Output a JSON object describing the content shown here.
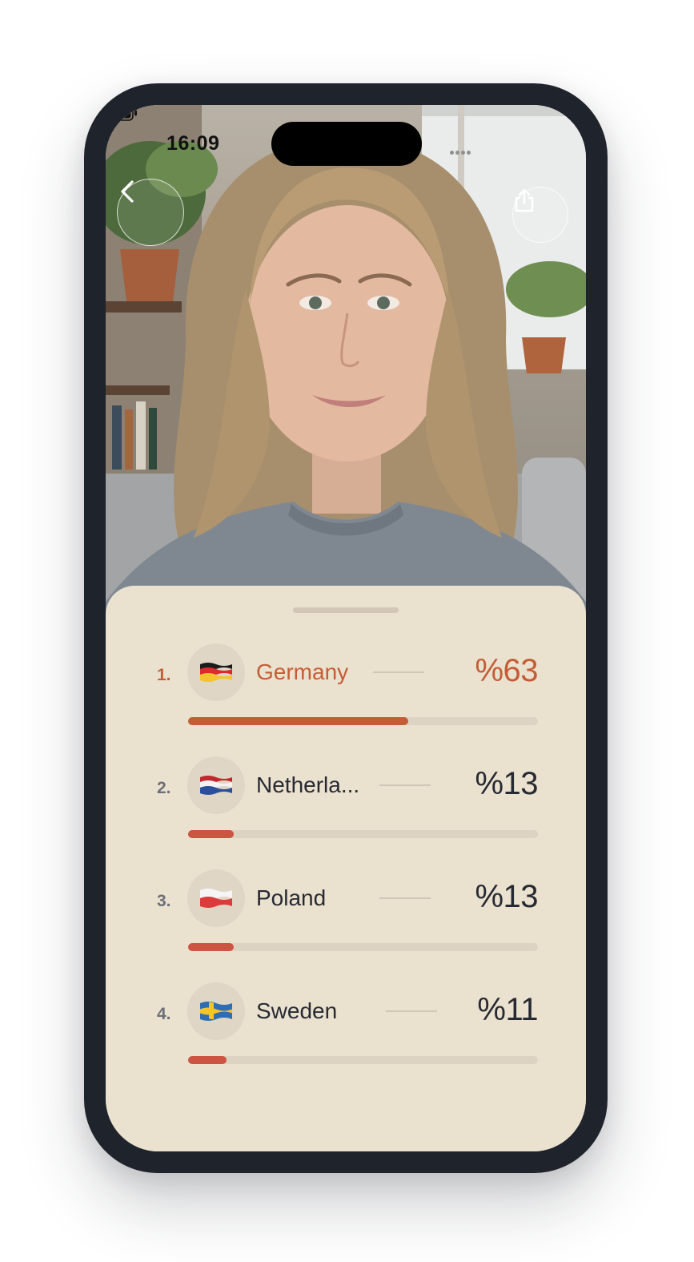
{
  "status_bar": {
    "time": "16:09"
  },
  "header": {
    "back_icon": "chevron-left-icon",
    "share_icon": "share-icon"
  },
  "results": [
    {
      "rank": "1.",
      "country": "Germany",
      "flag": "germany-flag-icon",
      "percent_label": "%63",
      "percent": 63
    },
    {
      "rank": "2.",
      "country": "Netherla...",
      "flag": "netherlands-flag-icon",
      "percent_label": "%13",
      "percent": 13
    },
    {
      "rank": "3.",
      "country": "Poland",
      "flag": "poland-flag-icon",
      "percent_label": "%13",
      "percent": 13
    },
    {
      "rank": "4.",
      "country": "Sweden",
      "flag": "sweden-flag-icon",
      "percent_label": "%11",
      "percent": 11
    }
  ],
  "colors": {
    "top_accent": "#c45d35",
    "bar_accent": "#cc5440",
    "sheet_background": "#ebe1cf"
  }
}
